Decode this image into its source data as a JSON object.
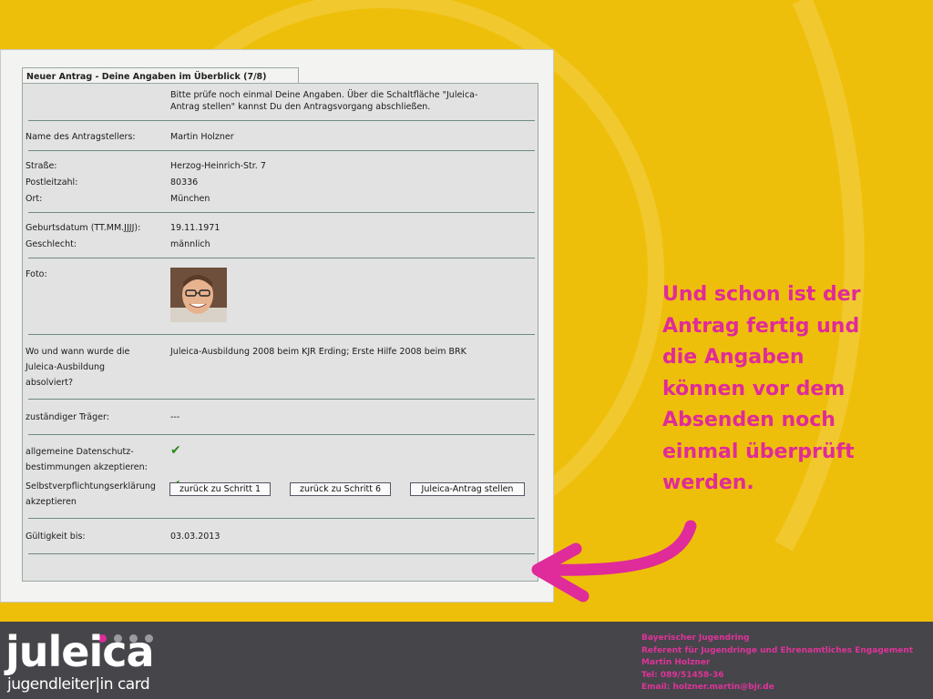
{
  "tab_title": "Neuer Antrag - Deine Angaben im Überblick (7/8)",
  "intro": [
    "Bitte prüfe noch einmal Deine Angaben. Über die Schaltfläche \"Juleica-",
    "Antrag stellen\" kannst Du den Antragsvorgang abschließen."
  ],
  "fields": {
    "name_label": "Name des Antragstellers:",
    "name_value": "Martin Holzner",
    "street_label": "Straße:",
    "street_value": "Herzog-Heinrich-Str. 7",
    "zip_label": "Postleitzahl:",
    "zip_value": "80336",
    "city_label": "Ort:",
    "city_value": "München",
    "birth_label": "Geburtsdatum (TT.MM.JJJJ):",
    "birth_value": "19.11.1971",
    "gender_label": "Geschlecht:",
    "gender_value": "männlich",
    "photo_label": "Foto:",
    "training_label": [
      "Wo und wann wurde die",
      "Juleica-Ausbildung",
      "absolviert?"
    ],
    "training_value": "Juleica-Ausbildung 2008 beim KJR Erding; Erste Hilfe 2008 beim BRK",
    "carrier_label": "zuständiger Träger:",
    "carrier_value": "---",
    "privacy_label": [
      "allgemeine Datenschutz-",
      "bestimmungen akzeptieren:"
    ],
    "commitment_label": [
      "Selbstverpflichtungserklärung",
      "akzeptieren"
    ],
    "validity_label": "Gültigkeit bis:",
    "validity_value": "03.03.2013"
  },
  "buttons": {
    "back1": "zurück zu Schritt 1",
    "back6": "zurück zu Schritt 6",
    "submit": "Juleica-Antrag stellen"
  },
  "callout": [
    "Und schon ist der",
    "Antrag fertig und",
    "die Angaben",
    "können vor dem",
    "Absenden noch",
    "einmal überprüft",
    "werden."
  ],
  "logo": {
    "word": "juleica",
    "sub": "jugendleiter|in card"
  },
  "contact": [
    "Bayerischer Jugendring",
    "Referent für Jugendringe und Ehrenamtliches Engagement",
    "Martin Holzner",
    "Tel: 089/51458-36",
    "Email: holzner.martin@bjr.de"
  ],
  "colors": {
    "background": "#eebf0a",
    "accent": "#e02b9a",
    "footer": "#45454a",
    "check": "#2f8a1e"
  },
  "icons": {
    "check": "checkmark-icon",
    "arrow": "pointer-arrow-icon"
  }
}
